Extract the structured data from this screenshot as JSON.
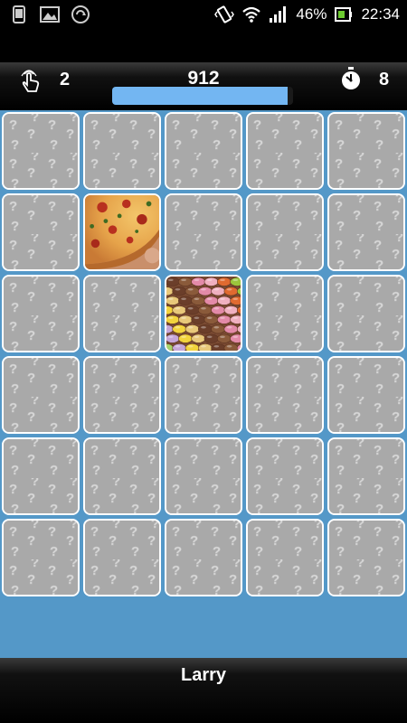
{
  "status_bar": {
    "battery_percent": "46%",
    "time": "22:34",
    "icons": [
      "phone-icon",
      "image-icon",
      "sync-icon",
      "vibrate-icon",
      "wifi-icon",
      "signal-icon",
      "battery-icon"
    ]
  },
  "header": {
    "moves": "2",
    "score": "912",
    "progress": 0.97,
    "timer": "8",
    "progress_color": "#73b6f2"
  },
  "board": {
    "rows": 6,
    "cols": 5,
    "background": "#5498c8",
    "revealed": [
      {
        "row": 1,
        "col": 1,
        "image": "pizza"
      },
      {
        "row": 2,
        "col": 2,
        "image": "candy"
      }
    ]
  },
  "footer": {
    "player_name": "Larry"
  }
}
